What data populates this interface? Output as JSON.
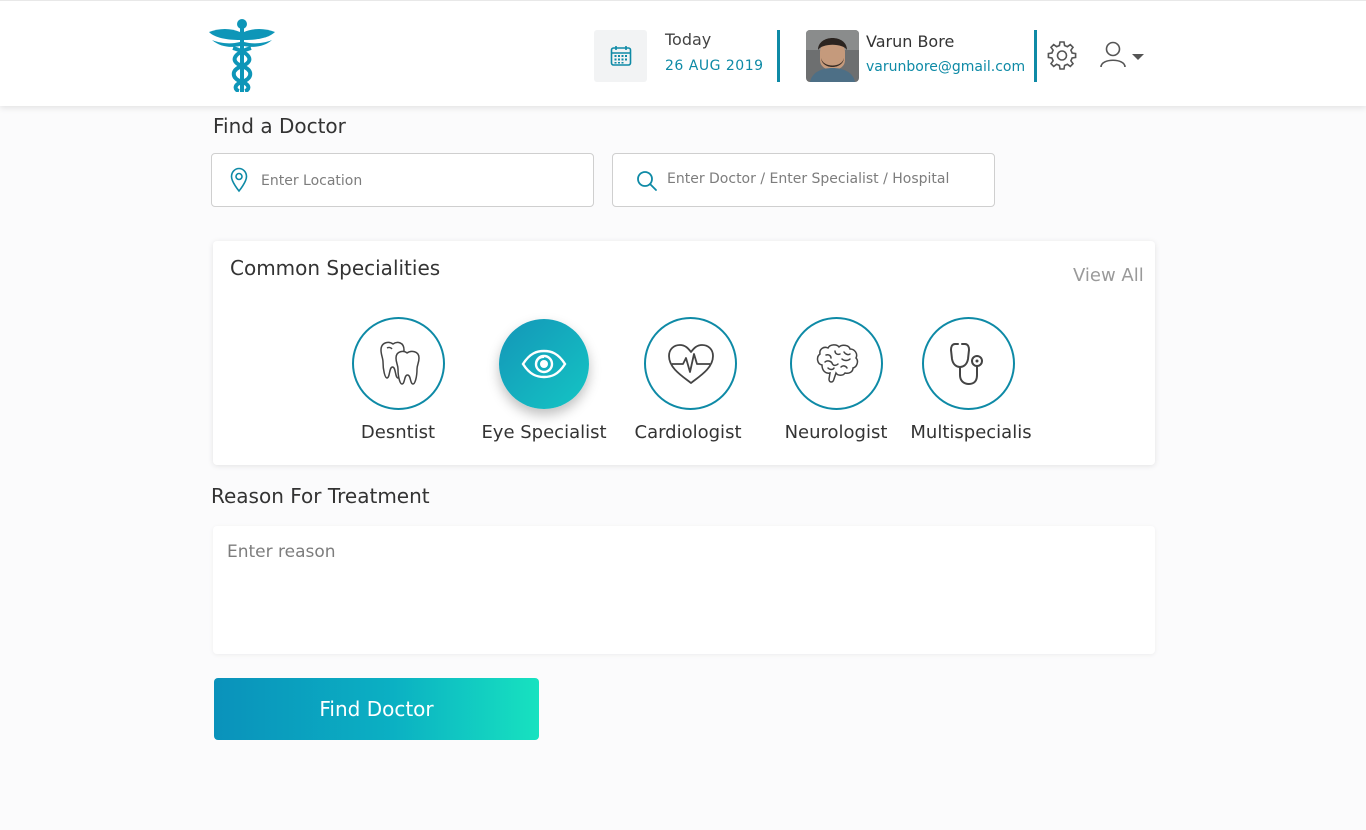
{
  "header": {
    "date": {
      "label": "Today",
      "value": "26 AUG 2019",
      "icon": "calendar-icon"
    },
    "user": {
      "name": "Varun Bore",
      "email": "varunbore@gmail.com",
      "avatar": "user-photo"
    },
    "settings_icon": "gear-icon",
    "profile_icon": "user-icon"
  },
  "find_doctor": {
    "title": "Find a Doctor",
    "location_placeholder": "Enter Location",
    "search_placeholder": "Enter Doctor / Enter Specialist / Hospital"
  },
  "specialities": {
    "title": "Common Specialities",
    "view_all": "View All",
    "items": [
      {
        "label": "Desntist",
        "icon": "tooth-icon",
        "active": false
      },
      {
        "label": "Eye Specialist",
        "icon": "eye-icon",
        "active": true
      },
      {
        "label": "Cardiologist",
        "icon": "heart-pulse-icon",
        "active": false
      },
      {
        "label": "Neurologist",
        "icon": "brain-icon",
        "active": false
      },
      {
        "label": "Multispecialis",
        "icon": "stethoscope-icon",
        "active": false
      }
    ]
  },
  "reason": {
    "title": "Reason For Treatment",
    "placeholder": "Enter reason"
  },
  "actions": {
    "find_label": "Find Doctor"
  },
  "colors": {
    "accent": "#0e8aa6",
    "gradient_start": "#0a92bb",
    "gradient_end": "#17e2c0"
  }
}
